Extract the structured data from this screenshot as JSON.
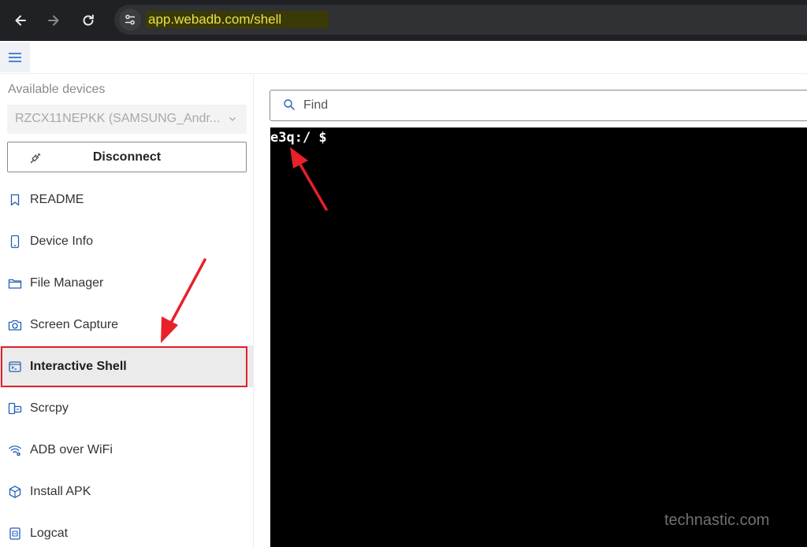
{
  "browser": {
    "url": "app.webadb.com/shell",
    "icons": {
      "back": "arrow-left-icon",
      "forward": "arrow-right-icon",
      "reload": "reload-icon",
      "site_info": "tune-icon"
    },
    "colors": {
      "chrome_bg": "#202124",
      "omnibox_bg": "#303134",
      "url_text": "#e8e04a"
    }
  },
  "appbar": {
    "menu_icon": "hamburger-menu-icon"
  },
  "sidebar": {
    "title": "Available devices",
    "device_select": {
      "value": "RZCX11NEPKK (SAMSUNG_Andr..."
    },
    "disconnect_label": "Disconnect",
    "items": [
      {
        "label": "README",
        "icon": "bookmark-icon"
      },
      {
        "label": "Device Info",
        "icon": "phone-icon"
      },
      {
        "label": "File Manager",
        "icon": "folder-icon"
      },
      {
        "label": "Screen Capture",
        "icon": "camera-icon"
      },
      {
        "label": "Interactive Shell",
        "icon": "terminal-icon",
        "active": true
      },
      {
        "label": "Scrcpy",
        "icon": "mirror-screen-icon"
      },
      {
        "label": "ADB over WiFi",
        "icon": "wifi-settings-icon"
      },
      {
        "label": "Install APK",
        "icon": "box-icon"
      },
      {
        "label": "Logcat",
        "icon": "log-icon"
      }
    ]
  },
  "main": {
    "find_placeholder": "Find",
    "terminal_prompt": "e3q:/ $"
  },
  "watermark": "technastic.com",
  "colors": {
    "highlight_border": "#e0212b",
    "annotation_arrow": "#e8202a",
    "terminal_bg": "#000000"
  }
}
